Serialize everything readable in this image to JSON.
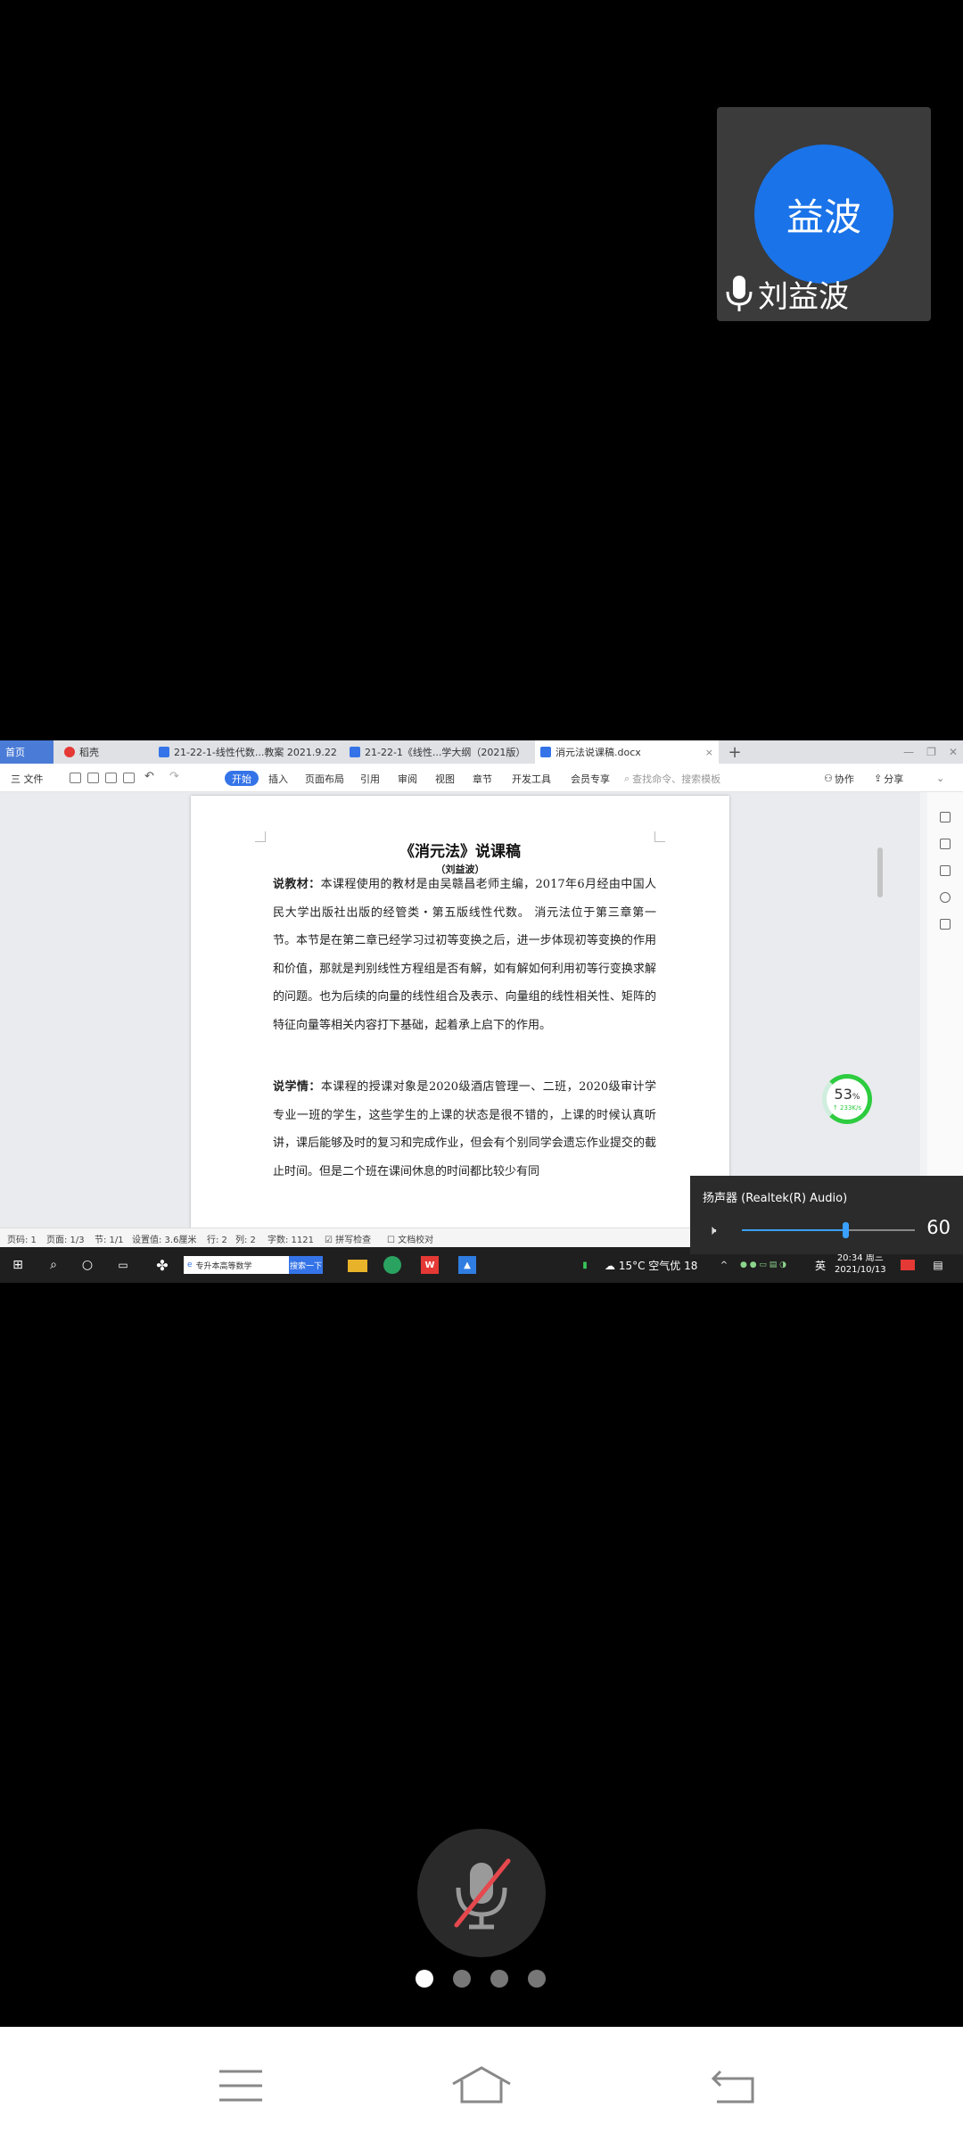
{
  "participant": {
    "avatar_text": "益波",
    "name": "刘益波"
  },
  "wps": {
    "tabs": {
      "home": "首页",
      "daoke": "稻壳",
      "doc1": "21-22-1-线性代数...教案 2021.9.22",
      "doc2": "21-22-1《线性...学大纲（2021版）",
      "doc3": "消元法说课稿.docx"
    },
    "menu": {
      "file": "三 文件",
      "items": [
        "开始",
        "插入",
        "页面布局",
        "引用",
        "审阅",
        "视图",
        "章节",
        "开发工具",
        "会员专享"
      ],
      "search_placeholder": "查找命令、搜索模板",
      "collab": "协作",
      "share": "分享"
    },
    "document": {
      "title": "《消元法》说课稿",
      "author": "（刘益波）",
      "para1_label": "说教材：",
      "para1_text": "本课程使用的教材是由吴赣昌老师主编，2017年6月经由中国人民大学出版社出版的经管类・第五版线性代数。 消元法位于第三章第一节。本节是在第二章已经学习过初等变换之后，进一步体现初等变换的作用和价值，那就是判别线性方程组是否有解，如有解如何利用初等行变换求解的问题。也为后续的向量的线性组合及表示、向量组的线性相关性、矩阵的特征向量等相关内容打下基础，起着承上启下的作用。",
      "para2_label": "说学情：",
      "para2_text": "本课程的授课对象是2020级酒店管理一、二班，2020级审计学专业一班的学生，这些学生的上课的状态是很不错的，上课的时候认真听讲，课后能够及时的复习和完成作业，但会有个别同学会遗忘作业提交的截止时间。但是二个班在课间休息的时间都比较少有同"
    },
    "net": {
      "percent": "53",
      "percent_unit": "%",
      "speed": "↑ 233K/s"
    },
    "status": {
      "page": "页码: 1",
      "pages": "页面: 1/3",
      "section": "节: 1/1",
      "setting": "设置值: 3.6厘米",
      "row": "行: 2",
      "col": "列: 2",
      "words": "字数: 1121",
      "spell": "拼写检查",
      "proof": "文档校对"
    },
    "volume": {
      "title": "扬声器 (Realtek(R) Audio)",
      "value": "60",
      "level": 0.6
    },
    "taskbar": {
      "search_text": "专升本高等数学",
      "search_button": "搜索一下",
      "weather": "15°C  空气优 18",
      "lang": "英",
      "time": "20:34 周三",
      "date": "2021/10/13"
    }
  },
  "pager": {
    "count": 4,
    "active": 0
  }
}
